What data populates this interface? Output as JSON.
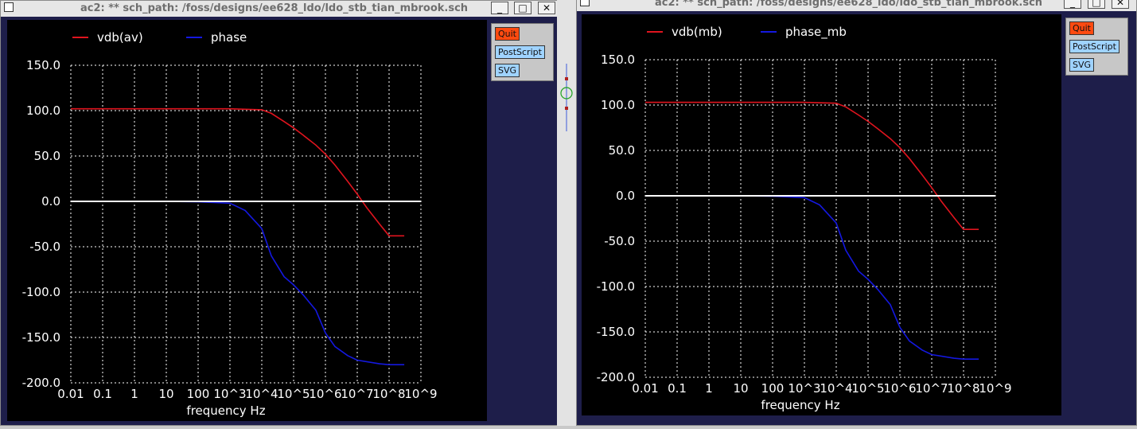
{
  "windows": [
    {
      "id": "left",
      "title": "ac2: ** sch_path: /foss/designs/ee628_ldo/ldo_stb_tian_mbrook.sch",
      "title_buttons": {
        "minimize": "_",
        "maximize": "□",
        "close": "✕"
      },
      "buttons": {
        "quit": "Quit",
        "postscript": "PostScript",
        "svg": "SVG"
      },
      "legend": [
        {
          "label": "vdb(av)",
          "color": "#e0141e"
        },
        {
          "label": "phase",
          "color": "#1418e0"
        }
      ],
      "x_title": "frequency    Hz",
      "x_ticks": [
        "0.01",
        "0.1",
        "1",
        "10",
        "100",
        "10^3",
        "10^4",
        "10^5",
        "10^6",
        "10^7",
        "10^8",
        "10^9"
      ],
      "y_ticks": [
        "150.0",
        "100.0",
        "50.0",
        "0.0",
        "-50.0",
        "-100.0",
        "-150.0",
        "-200.0"
      ]
    },
    {
      "id": "right",
      "title": "ac2: ** sch_path: /foss/designs/ee628_ldo/ldo_stb_tian_mbrook.sch",
      "title_buttons": {
        "minimize": "_",
        "maximize": "□",
        "close": "✕"
      },
      "buttons": {
        "quit": "Quit",
        "postscript": "PostScript",
        "svg": "SVG"
      },
      "legend": [
        {
          "label": "vdb(mb)",
          "color": "#e0141e"
        },
        {
          "label": "phase_mb",
          "color": "#1418e0"
        }
      ],
      "x_title": "frequency    Hz",
      "x_ticks": [
        "0.01",
        "0.1",
        "1",
        "10",
        "100",
        "10^3",
        "10^4",
        "10^5",
        "10^6",
        "10^7",
        "10^8",
        "10^9"
      ],
      "y_ticks": [
        "150.0",
        "100.0",
        "50.0",
        "0.0",
        "-50.0",
        "-100.0",
        "-150.0",
        "-200.0"
      ]
    }
  ],
  "chart_data": [
    {
      "type": "line",
      "xlabel": "frequency    Hz",
      "xscale": "log",
      "xlim": [
        0.01,
        1000000000
      ],
      "ylim": [
        -200,
        150
      ],
      "grid": true,
      "legend_position": "top-left",
      "series": [
        {
          "name": "vdb(av)",
          "color": "#e0141e",
          "x": [
            0.01,
            0.1,
            1,
            10,
            100,
            1000,
            10000,
            20000,
            50000,
            100000,
            200000,
            500000,
            1000000,
            2000000,
            5000000,
            10000000,
            20000000,
            50000000,
            100000000,
            300000000
          ],
          "y": [
            102,
            102,
            102,
            102,
            102,
            102,
            101,
            97,
            88,
            81,
            73,
            62,
            52,
            40,
            22,
            8,
            -7,
            -25,
            -38,
            -38
          ]
        },
        {
          "name": "phase",
          "color": "#1418e0",
          "x": [
            0.01,
            0.1,
            1,
            10,
            100,
            1000,
            3000,
            10000,
            20000,
            50000,
            100000,
            200000,
            500000,
            1000000,
            2000000,
            5000000,
            10000000,
            50000000,
            100000000,
            300000000
          ],
          "y": [
            0,
            0,
            0,
            0,
            -0.5,
            -2,
            -10,
            -30,
            -60,
            -83,
            -92,
            -103,
            -120,
            -145,
            -160,
            -170,
            -175,
            -179,
            -180,
            -180
          ]
        },
        {
          "name": "",
          "color": "#ffffff",
          "x": [
            0.01,
            1000000000
          ],
          "y": [
            0,
            0
          ]
        }
      ]
    },
    {
      "type": "line",
      "xlabel": "frequency    Hz",
      "xscale": "log",
      "xlim": [
        0.01,
        1000000000
      ],
      "ylim": [
        -200,
        150
      ],
      "grid": true,
      "legend_position": "top-left",
      "series": [
        {
          "name": "vdb(mb)",
          "color": "#e0141e",
          "x": [
            0.01,
            0.1,
            1,
            10,
            100,
            1000,
            10000,
            20000,
            50000,
            100000,
            200000,
            500000,
            1000000,
            2000000,
            5000000,
            10000000,
            20000000,
            50000000,
            100000000,
            300000000
          ],
          "y": [
            103,
            103,
            103,
            103,
            103,
            103,
            102,
            98,
            89,
            82,
            74,
            63,
            53,
            41,
            23,
            9,
            -6,
            -24,
            -37,
            -37
          ]
        },
        {
          "name": "phase_mb",
          "color": "#1418e0",
          "x": [
            0.01,
            0.1,
            1,
            10,
            100,
            1000,
            3000,
            10000,
            20000,
            50000,
            100000,
            200000,
            500000,
            1000000,
            2000000,
            5000000,
            10000000,
            50000000,
            100000000,
            300000000
          ],
          "y": [
            0,
            0,
            0,
            0,
            -0.5,
            -2,
            -10,
            -30,
            -60,
            -83,
            -92,
            -103,
            -120,
            -145,
            -160,
            -170,
            -175,
            -179,
            -180,
            -180
          ]
        },
        {
          "name": "",
          "color": "#ffffff",
          "x": [
            0.01,
            1000000000
          ],
          "y": [
            0,
            0
          ]
        }
      ]
    }
  ]
}
